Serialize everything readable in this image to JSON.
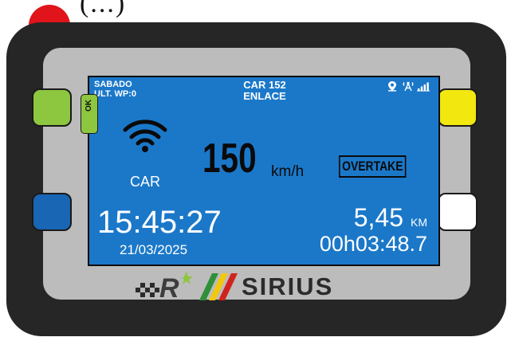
{
  "header_fragment": "(...)",
  "device": {
    "colors": {
      "body": "#262626",
      "bezel": "#bcbcbc",
      "screen": "#1b78c9",
      "button_top_left": "#8dc63f",
      "button_bottom_left": "#1866b4",
      "button_top_right": "#f2e70f",
      "button_bottom_right": "#ffffff",
      "power_button": "#e0141a"
    },
    "ok_label": "OK",
    "brand": "SIRIUS",
    "logo_letter": "R"
  },
  "screen": {
    "day": "SABADO",
    "last_waypoint": "ULT. WP:0",
    "car_id": "CAR 152",
    "link_status": "ENLACE",
    "status_icons": [
      "location-pin-icon",
      "antenna-icon",
      "signal-bars-icon"
    ],
    "source_label": "CAR",
    "speed": "150",
    "speed_unit": "km/h",
    "alert": "OVERTAKE",
    "time": "15:45:27",
    "date": "21/03/2025",
    "distance": "5,45",
    "distance_unit": "KM",
    "elapsed": "00h03:48.7"
  }
}
